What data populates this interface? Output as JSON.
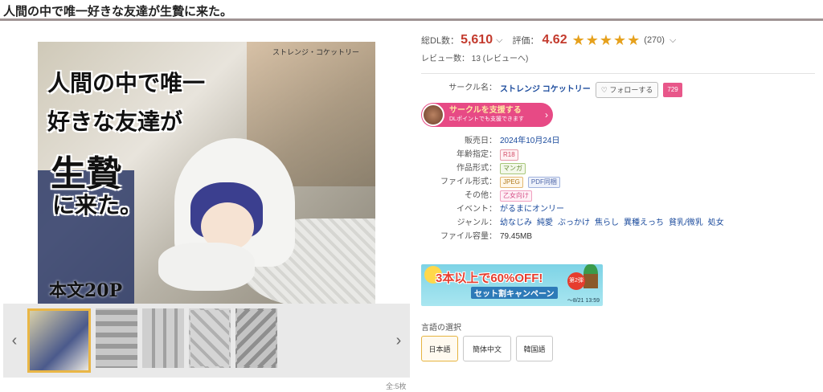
{
  "page_title": "人間の中で唯一好きな友達が生贄に来た。",
  "cover": {
    "title_lines": [
      "人間の中で唯一",
      "好きな友達が",
      "生贄",
      "に来た。"
    ],
    "page_note": "本文20P",
    "credit": "ストレンジ・コケットリー"
  },
  "gallery": {
    "prev_arrow": "‹",
    "next_arrow": "›",
    "page_count": "全:5枚"
  },
  "stats": {
    "dl_label": "総DL数：",
    "dl_value": "5,610",
    "rating_label": "評価：",
    "rating_value": "4.62",
    "stars": "★★★★★",
    "rating_count": "(270)",
    "chevron": "⌵",
    "review_label": "レビュー数：",
    "review_value": "13",
    "review_link": "(レビューへ)"
  },
  "circle": {
    "label": "サークル名：",
    "name": "ストレンジ コケットリー",
    "follow_label": "フォローする",
    "heart": "♡",
    "follow_count": "729",
    "support_line1": "サークルを支援する",
    "support_line2": "DLポイントでも支援できます",
    "support_arrow": "›"
  },
  "details": {
    "release_label": "販売日：",
    "release_value": "2024年10月24日",
    "age_label": "年齢指定：",
    "age_value": "R18",
    "format_label": "作品形式：",
    "format_value": "マンガ",
    "file_format_label": "ファイル形式：",
    "file_format_values": [
      "JPEG",
      "PDF同梱"
    ],
    "other_label": "その他：",
    "other_value": "乙女向け",
    "event_label": "イベント：",
    "event_value": "がるまにオンリー",
    "genre_label": "ジャンル：",
    "genres": [
      "幼なじみ",
      "純愛",
      "ぶっかけ",
      "焦らし",
      "異種えっち",
      "貧乳/微乳",
      "処女"
    ],
    "size_label": "ファイル容量：",
    "size_value": "79.45MB"
  },
  "banner": {
    "main": "3本以上で60%OFF!",
    "sub": "セット割キャンペーン",
    "badge": "第2弾",
    "date": "〜8/21 13:59"
  },
  "language": {
    "label": "言語の選択",
    "options": [
      "日本語",
      "簡体中文",
      "韓国語"
    ],
    "selected": "日本語"
  },
  "colors": {
    "accent_red": "#c33a2d",
    "star": "#e6a11d",
    "link": "#1a4a9c",
    "support_pink": "#e74a85"
  }
}
